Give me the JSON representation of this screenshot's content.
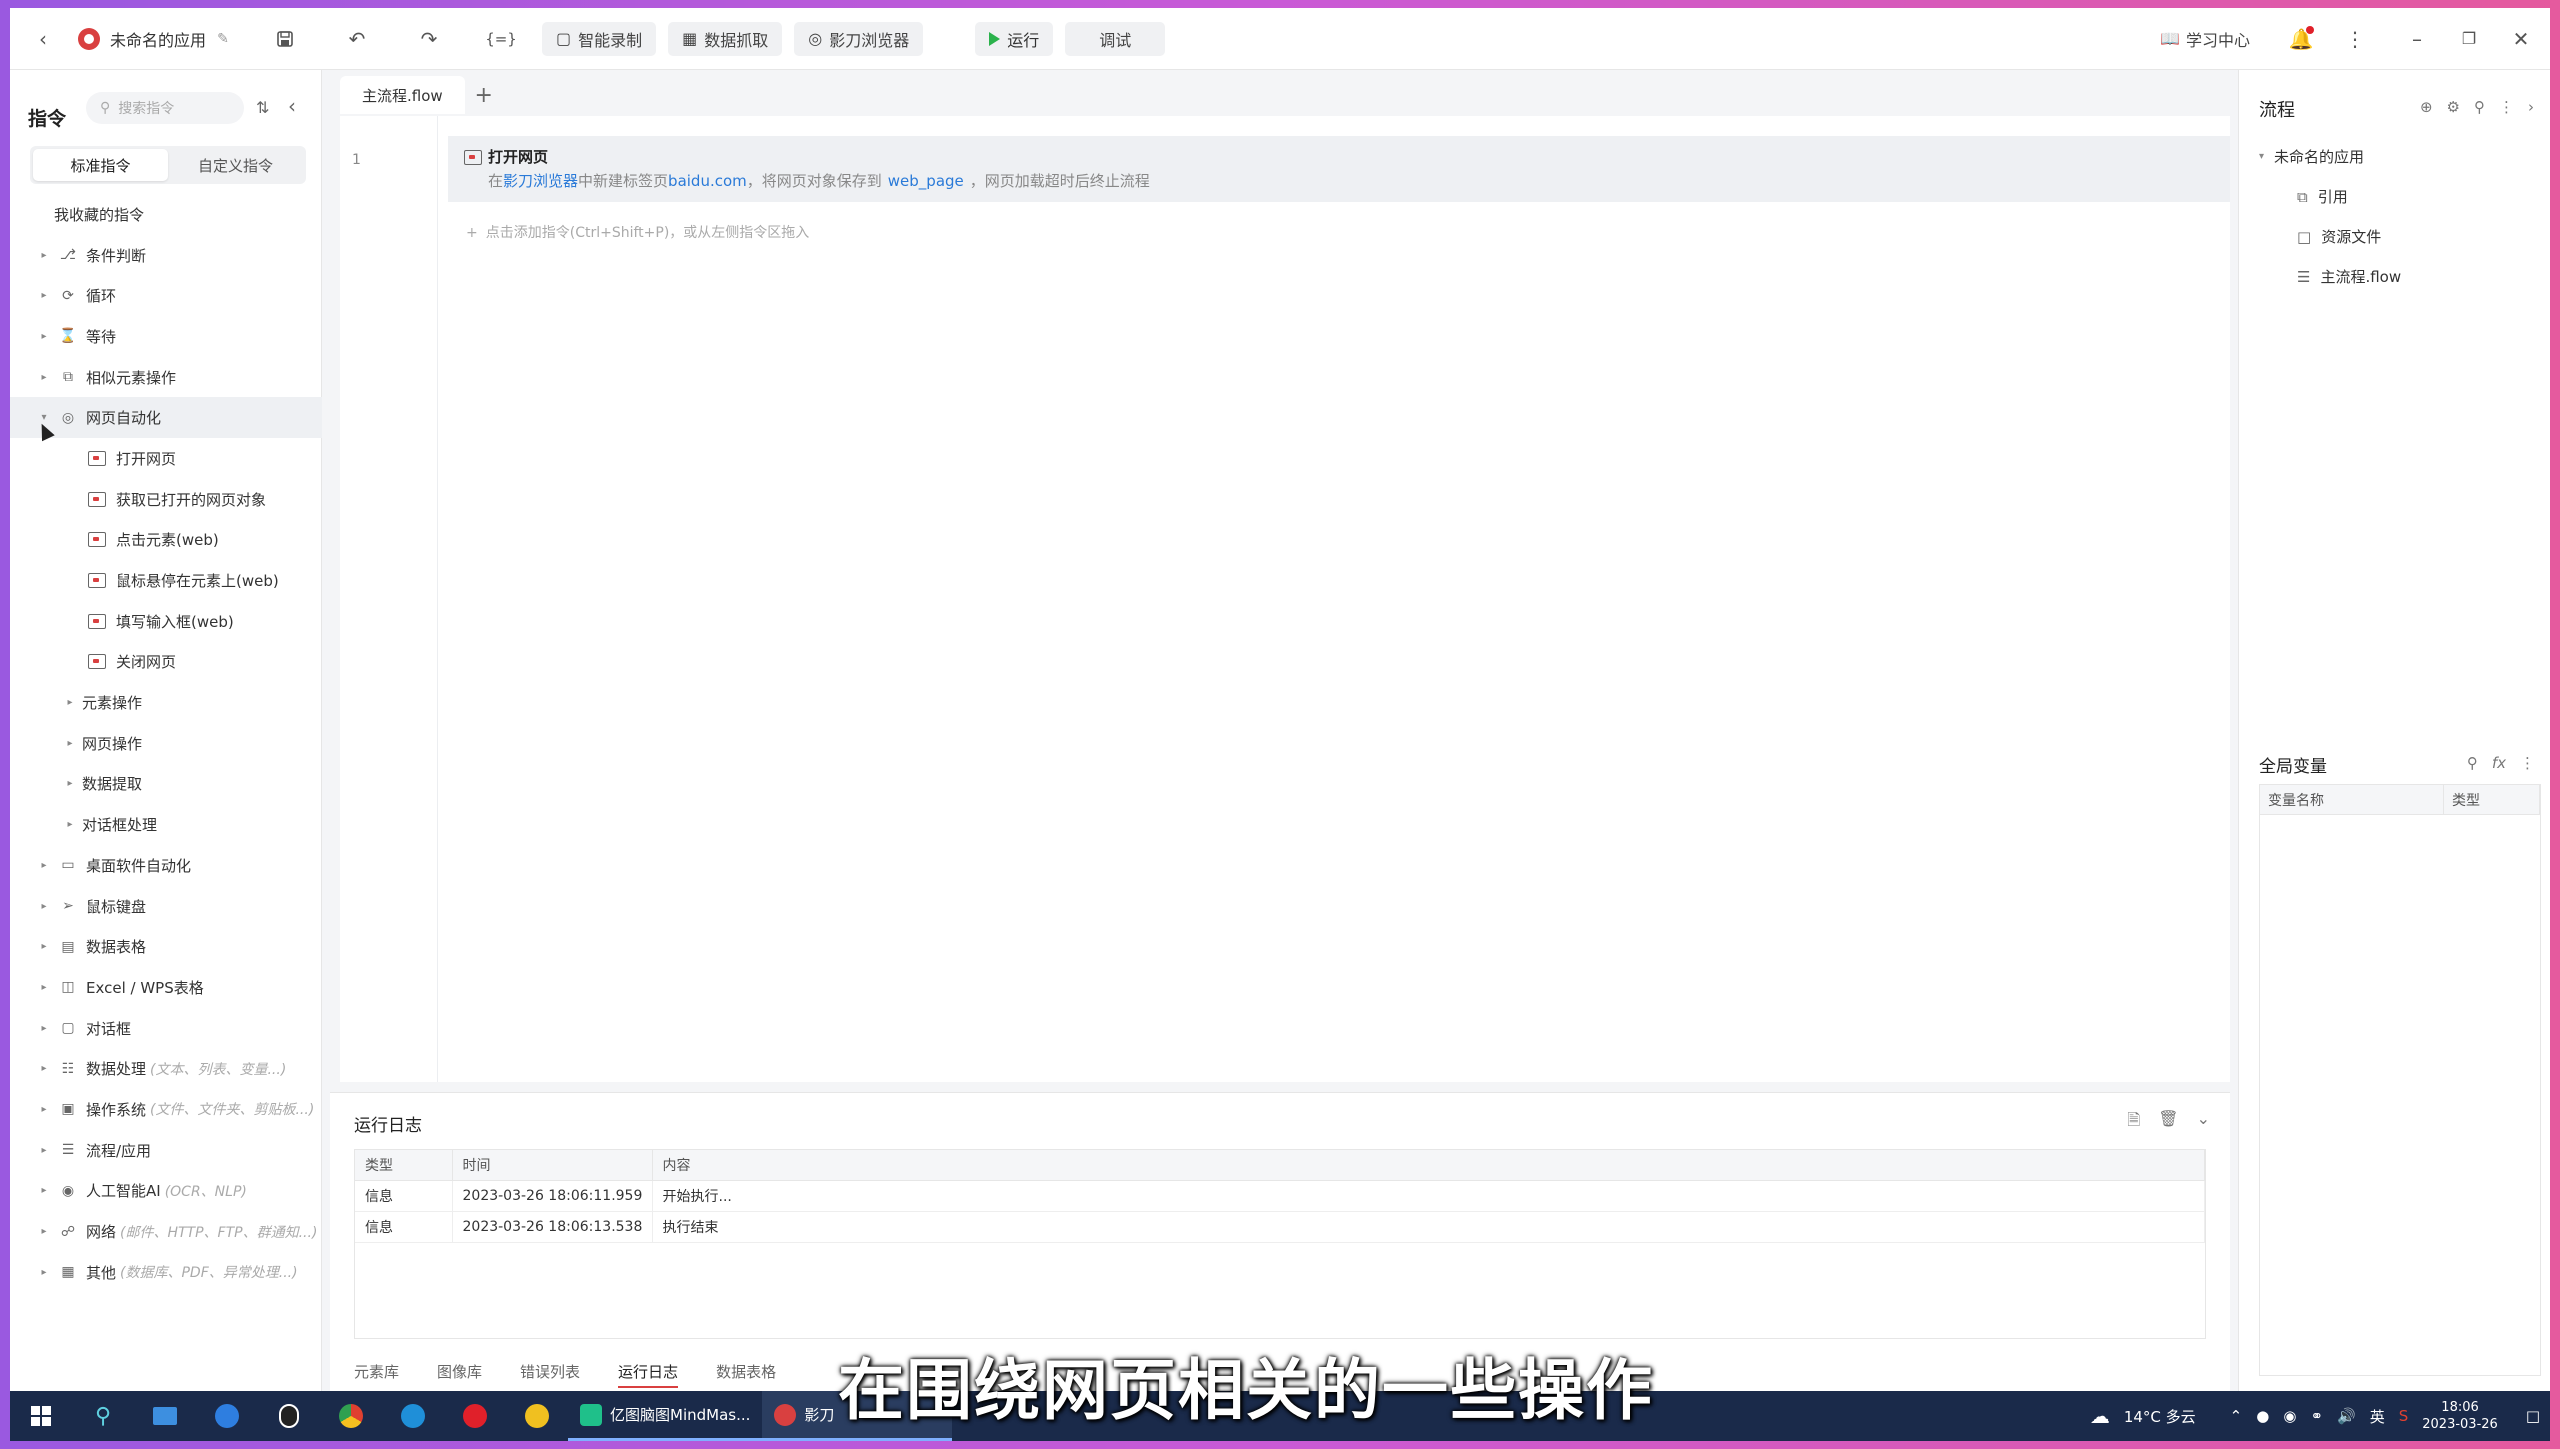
{
  "topbar": {
    "app_name": "未命名的应用",
    "smart_record": "智能录制",
    "data_grab": "数据抓取",
    "browser": "影刀浏览器",
    "run": "运行",
    "debug": "调试",
    "learn": "学习中心"
  },
  "left": {
    "title": "指令",
    "search_placeholder": "搜索指令",
    "tab_standard": "标准指令",
    "tab_custom": "自定义指令",
    "favorites": "我收藏的指令",
    "items": [
      {
        "label": "条件判断"
      },
      {
        "label": "循环"
      },
      {
        "label": "等待"
      },
      {
        "label": "相似元素操作"
      },
      {
        "label": "网页自动化"
      }
    ],
    "web_children": [
      {
        "label": "打开网页"
      },
      {
        "label": "获取已打开的网页对象"
      },
      {
        "label": "点击元素(web)"
      },
      {
        "label": "鼠标悬停在元素上(web)"
      },
      {
        "label": "填写输入框(web)"
      },
      {
        "label": "关闭网页"
      }
    ],
    "web_groups": [
      {
        "label": "元素操作"
      },
      {
        "label": "网页操作"
      },
      {
        "label": "数据提取"
      },
      {
        "label": "对话框处理"
      }
    ],
    "more_items": [
      {
        "label": "桌面软件自动化",
        "hint": ""
      },
      {
        "label": "鼠标键盘",
        "hint": ""
      },
      {
        "label": "数据表格",
        "hint": ""
      },
      {
        "label": "Excel / WPS表格",
        "hint": ""
      },
      {
        "label": "对话框",
        "hint": ""
      },
      {
        "label": "数据处理",
        "hint": "(文本、列表、变量...)"
      },
      {
        "label": "操作系统",
        "hint": "(文件、文件夹、剪贴板...)"
      },
      {
        "label": "流程/应用",
        "hint": ""
      },
      {
        "label": "人工智能AI",
        "hint": "(OCR、NLP)"
      },
      {
        "label": "网络",
        "hint": "(邮件、HTTP、FTP、群通知...)"
      },
      {
        "label": "其他",
        "hint": "(数据库、PDF、异常处理...)"
      }
    ]
  },
  "editor": {
    "tab": "主流程.flow",
    "line_no": "1",
    "cmd_title": "打开网页",
    "cmd_desc_1": "在",
    "cmd_desc_browser": "影刀浏览器",
    "cmd_desc_2": "中新建标签页",
    "cmd_desc_url": "baidu.com",
    "cmd_desc_3": "，将网页对象保存到",
    "cmd_desc_var": "web_page",
    "cmd_desc_4": "，网页加载超时后终止流程",
    "add_hint": "点击添加指令(Ctrl+Shift+P)，或从左侧指令区拖入"
  },
  "log": {
    "title": "运行日志",
    "columns": [
      "类型",
      "时间",
      "内容"
    ],
    "rows": [
      {
        "type": "信息",
        "time": "2023-03-26 18:06:11.959",
        "content": "开始执行..."
      },
      {
        "type": "信息",
        "time": "2023-03-26 18:06:13.538",
        "content": "执行结束"
      }
    ],
    "tabs": [
      "元素库",
      "图像库",
      "错误列表",
      "运行日志",
      "数据表格"
    ]
  },
  "right": {
    "title": "流程",
    "root": "未命名的应用",
    "items": [
      "引用",
      "资源文件",
      "主流程.flow"
    ],
    "globals_title": "全局变量",
    "col_name": "变量名称",
    "col_type": "类型"
  },
  "taskbar": {
    "app1": "亿图脑图MindMas...",
    "app2": "影刀",
    "weather": "14°C 多云",
    "ime": "英",
    "time": "18:06",
    "date": "2023-03-26"
  },
  "subtitle": "在围绕网页相关的一些操作"
}
